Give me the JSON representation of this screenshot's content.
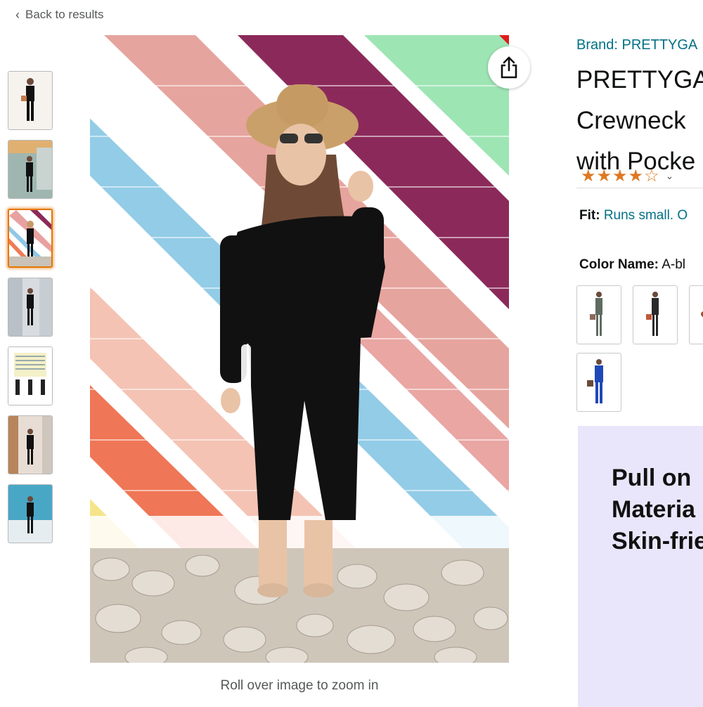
{
  "nav": {
    "back_label": "Back to results"
  },
  "gallery": {
    "thumbnail_count": 7,
    "selected_index": 2,
    "zoom_hint": "Roll over image to zoom in",
    "share_icon": "share-icon"
  },
  "product": {
    "brand": "Brand: PRETTYGA",
    "title_lines": [
      "PRETTYGA",
      "Crewneck",
      "with Pocke"
    ],
    "rating_stars": "★★★★☆",
    "rating_value": 4.5
  },
  "fit": {
    "label": "Fit:",
    "value": "Runs small. O"
  },
  "color": {
    "label": "Color Name:",
    "value": "A-bl"
  },
  "promo": {
    "lines": [
      "Pull on",
      "Materia",
      "Skin-frie"
    ]
  },
  "colors": {
    "accent": "#e77600",
    "link": "#007185",
    "star": "#de7921",
    "promo_bg": "#e9e6fb"
  }
}
